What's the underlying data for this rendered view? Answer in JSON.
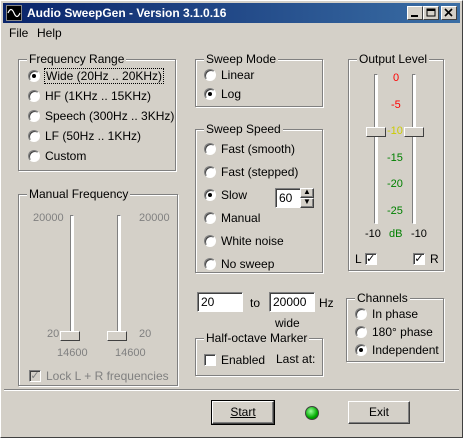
{
  "window": {
    "title": "Audio SweepGen - Version 3.1.0.16",
    "icon": "sine-wave-icon"
  },
  "menu": {
    "file": "File",
    "help": "Help"
  },
  "frequency_range": {
    "label": "Frequency Range",
    "options": [
      "Wide  (20Hz .. 20KHz)",
      "HF  (1KHz .. 15KHz)",
      "Speech  (300Hz .. 3KHz)",
      "LF  (50Hz .. 1KHz)",
      "Custom"
    ],
    "selected": 0
  },
  "manual_frequency": {
    "label": "Manual Frequency",
    "left_top": "20000",
    "left_mid": "20",
    "left_bottom": "14600",
    "right_top": "20000",
    "right_mid": "20",
    "right_bottom": "14600",
    "lock_label": "Lock L + R frequencies"
  },
  "sweep_mode": {
    "label": "Sweep Mode",
    "options": [
      "Linear",
      "Log"
    ],
    "selected": 1
  },
  "sweep_speed": {
    "label": "Sweep Speed",
    "options": [
      "Fast (smooth)",
      "Fast (stepped)",
      "Slow",
      "Manual",
      "White noise",
      "No sweep"
    ],
    "selected": 2,
    "slow_value": "60"
  },
  "range_inputs": {
    "from": "20",
    "to_label": "to",
    "to": "20000",
    "unit": "Hz",
    "caption": "wide"
  },
  "half_octave": {
    "label": "Half-octave Marker",
    "enabled_label": "Enabled",
    "last_at_label": "Last at:"
  },
  "output_level": {
    "label": "Output Level",
    "scale": [
      "0",
      "-5",
      "-10",
      "-15",
      "-20",
      "-25"
    ],
    "scale_colors": [
      "#ff0000",
      "#ff0000",
      "#cccc00",
      "#008000",
      "#008000",
      "#008000"
    ],
    "left_value": "-10",
    "unit": "dB",
    "right_value": "-10",
    "l_label": "L",
    "r_label": "R"
  },
  "channels": {
    "label": "Channels",
    "options": [
      "In phase",
      "180° phase",
      "Independent"
    ],
    "selected": 2
  },
  "buttons": {
    "start": "Start",
    "exit": "Exit"
  },
  "status_led_color": "#00aa00"
}
